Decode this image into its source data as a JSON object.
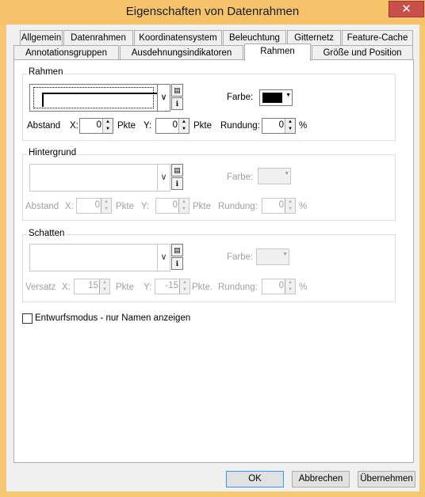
{
  "window": {
    "title": "Eigenschaften von Datenrahmen",
    "close_glyph": "✕"
  },
  "tabs_row1": [
    "Allgemein",
    "Datenrahmen",
    "Koordinatensystem",
    "Beleuchtung",
    "Gitternetz",
    "Feature-Cache"
  ],
  "tabs_row2": [
    "Annotationsgruppen",
    "Ausdehnungsindikatoren",
    "Rahmen",
    "Größe und Position"
  ],
  "active_tab": "Rahmen",
  "rahmen": {
    "group_label": "Rahmen",
    "farbe_label": "Farbe:",
    "color": "#000000",
    "abstand_label": "Abstand",
    "x_label": "X:",
    "x_value": "0",
    "x_unit": "Pkte",
    "y_label": "Y:",
    "y_value": "0",
    "y_unit": "Pkte",
    "rundung_label": "Rundung:",
    "rundung_value": "0",
    "percent": "%"
  },
  "hintergrund": {
    "group_label": "Hintergrund",
    "farbe_label": "Farbe:",
    "abstand_label": "Abstand",
    "x_label": "X:",
    "x_value": "0",
    "x_unit": "Pkte",
    "y_label": "Y:",
    "y_value": "0",
    "y_unit": "Pkte",
    "rundung_label": "Rundung:",
    "rundung_value": "0",
    "percent": "%"
  },
  "schatten": {
    "group_label": "Schatten",
    "farbe_label": "Farbe:",
    "versatz_label": "Versatz",
    "x_label": "X:",
    "x_value": "15",
    "x_unit": "Pkte",
    "y_label": "Y:",
    "y_value": "-15",
    "y_unit": "Pkte.",
    "rundung_label": "Rundung:",
    "rundung_value": "0",
    "percent": "%"
  },
  "draft_mode": {
    "label": "Entwurfsmodus - nur Namen anzeigen",
    "checked": false
  },
  "buttons": {
    "ok": "OK",
    "cancel": "Abbrechen",
    "apply": "Übernehmen"
  }
}
